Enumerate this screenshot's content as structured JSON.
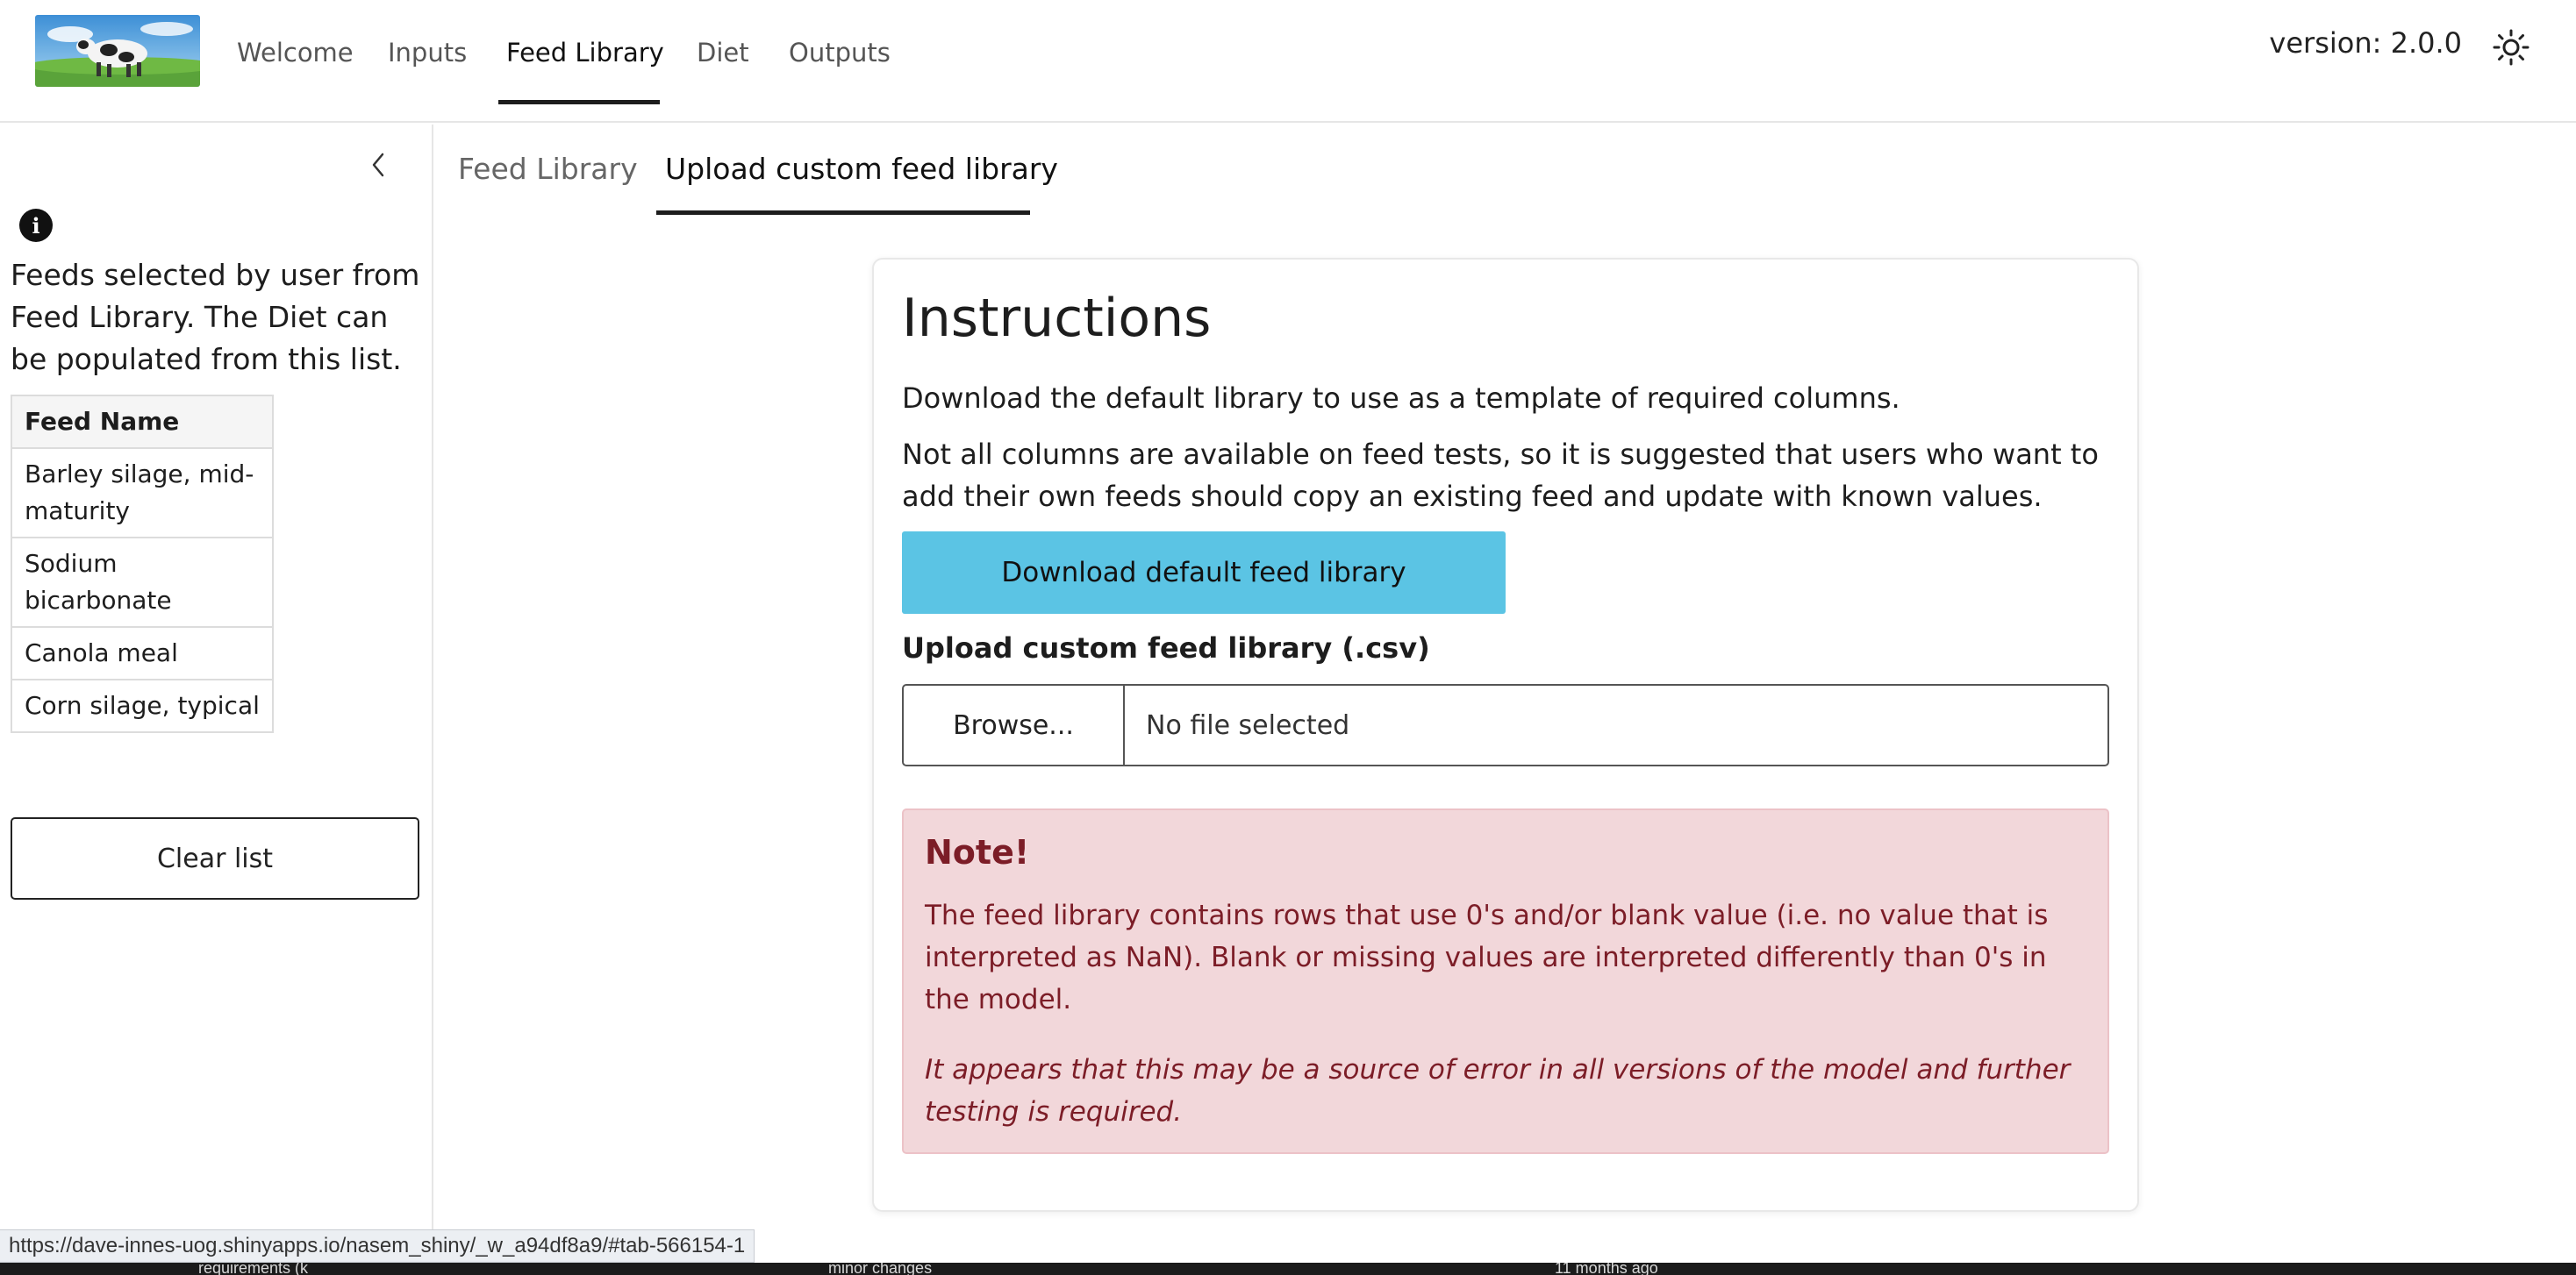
{
  "navbar": {
    "logo_alt": "cow logo",
    "tabs": [
      {
        "label": "Welcome"
      },
      {
        "label": "Inputs"
      },
      {
        "label": "Feed Library"
      },
      {
        "label": "Diet"
      },
      {
        "label": "Outputs"
      }
    ],
    "active_tab": "Feed Library",
    "version": "version: 2.0.0",
    "theme_icon": "sun-icon"
  },
  "sidebar": {
    "collapse_icon": "chevron-left-icon",
    "info_icon": "info-icon",
    "description": "Feeds selected by user from Feed Library. The Diet can be populated from this list.",
    "table": {
      "header": "Feed Name",
      "rows": [
        "Barley silage, mid-maturity",
        "Sodium bicarbonate",
        "Canola meal",
        "Corn silage, typical"
      ]
    },
    "clear_button": "Clear list"
  },
  "main": {
    "subtabs": [
      {
        "label": "Feed Library"
      },
      {
        "label": "Upload custom feed library"
      }
    ],
    "active_subtab": "Upload custom feed library",
    "card": {
      "title": "Instructions",
      "paragraph1": "Download the default library to use as a template of required columns.",
      "paragraph2": "Not all columns are available on feed tests, so it is suggested that users who want to add their own feeds should copy an existing feed and update with known values.",
      "download_button": "Download default feed library",
      "upload_label": "Upload custom feed library (.csv)",
      "browse_button": "Browse...",
      "file_status": "No file selected",
      "note": {
        "title": "Note!",
        "body": "The feed library contains rows that use 0's and/or blank value (i.e. no value that is interpreted as NaN). Blank or missing values are interpreted differently than 0's in the model.",
        "italic": "It appears that this may be a source of error in all versions of the model and further testing is required."
      }
    }
  },
  "status_bar": {
    "url": "https://dave-innes-uog.shinyapps.io/nasem_shiny/_w_a94df8a9/#tab-566154-1",
    "bottom_fragments": [
      "requirements (k",
      "minor changes",
      "11 months ago"
    ]
  },
  "colors": {
    "download_button": "#5bc4e4",
    "note_bg": "#f2d7da",
    "note_text": "#7c1d27"
  }
}
